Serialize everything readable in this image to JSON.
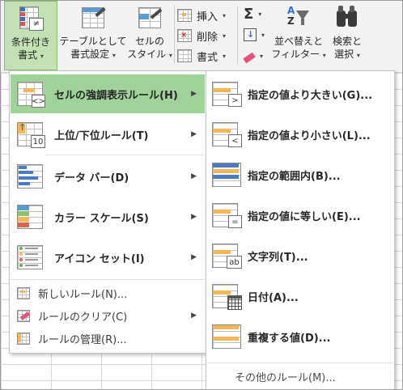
{
  "ribbon": {
    "conditional_formatting": {
      "line1": "条件付き",
      "line2": "書式"
    },
    "format_as_table": {
      "line1": "テーブルとして",
      "line2": "書式設定"
    },
    "cell_styles": {
      "line1": "セルの",
      "line2": "スタイル"
    },
    "insert_label": "挿入",
    "delete_label": "削除",
    "format_label": "書式",
    "sort_filter": {
      "line1": "並べ替えと",
      "line2": "フィルター"
    },
    "find_select": {
      "line1": "検索と",
      "line2": "選択"
    }
  },
  "menu": {
    "items": [
      {
        "label": "セルの強調表示ルール(H)"
      },
      {
        "label": "上位/下位ルール(T)"
      },
      {
        "label": "データ バー(D)"
      },
      {
        "label": "カラー スケール(S)"
      },
      {
        "label": "アイコン セット(I)"
      }
    ],
    "small_items": [
      {
        "label": "新しいルール(N)..."
      },
      {
        "label": "ルールのクリア(C)"
      },
      {
        "label": "ルールの管理(R)..."
      }
    ]
  },
  "submenu": {
    "items": [
      {
        "label": "指定の値より大きい(G)...",
        "badge": ">"
      },
      {
        "label": "指定の値より小さい(L)...",
        "badge": "<"
      },
      {
        "label": "指定の範囲内(B)..."
      },
      {
        "label": "指定の値に等しい(E)...",
        "badge": "="
      },
      {
        "label": "文字列(T)...",
        "badge": "ab"
      },
      {
        "label": "日付(A)..."
      },
      {
        "label": "重複する値(D)..."
      }
    ],
    "footer_label": "その他のルール(M)..."
  },
  "colors": {
    "active_green": "#9fd39a",
    "ribbon_active": "#c5e0b4",
    "highlight_orange": "#f4b656",
    "bar_blue": "#4a7ac3"
  }
}
